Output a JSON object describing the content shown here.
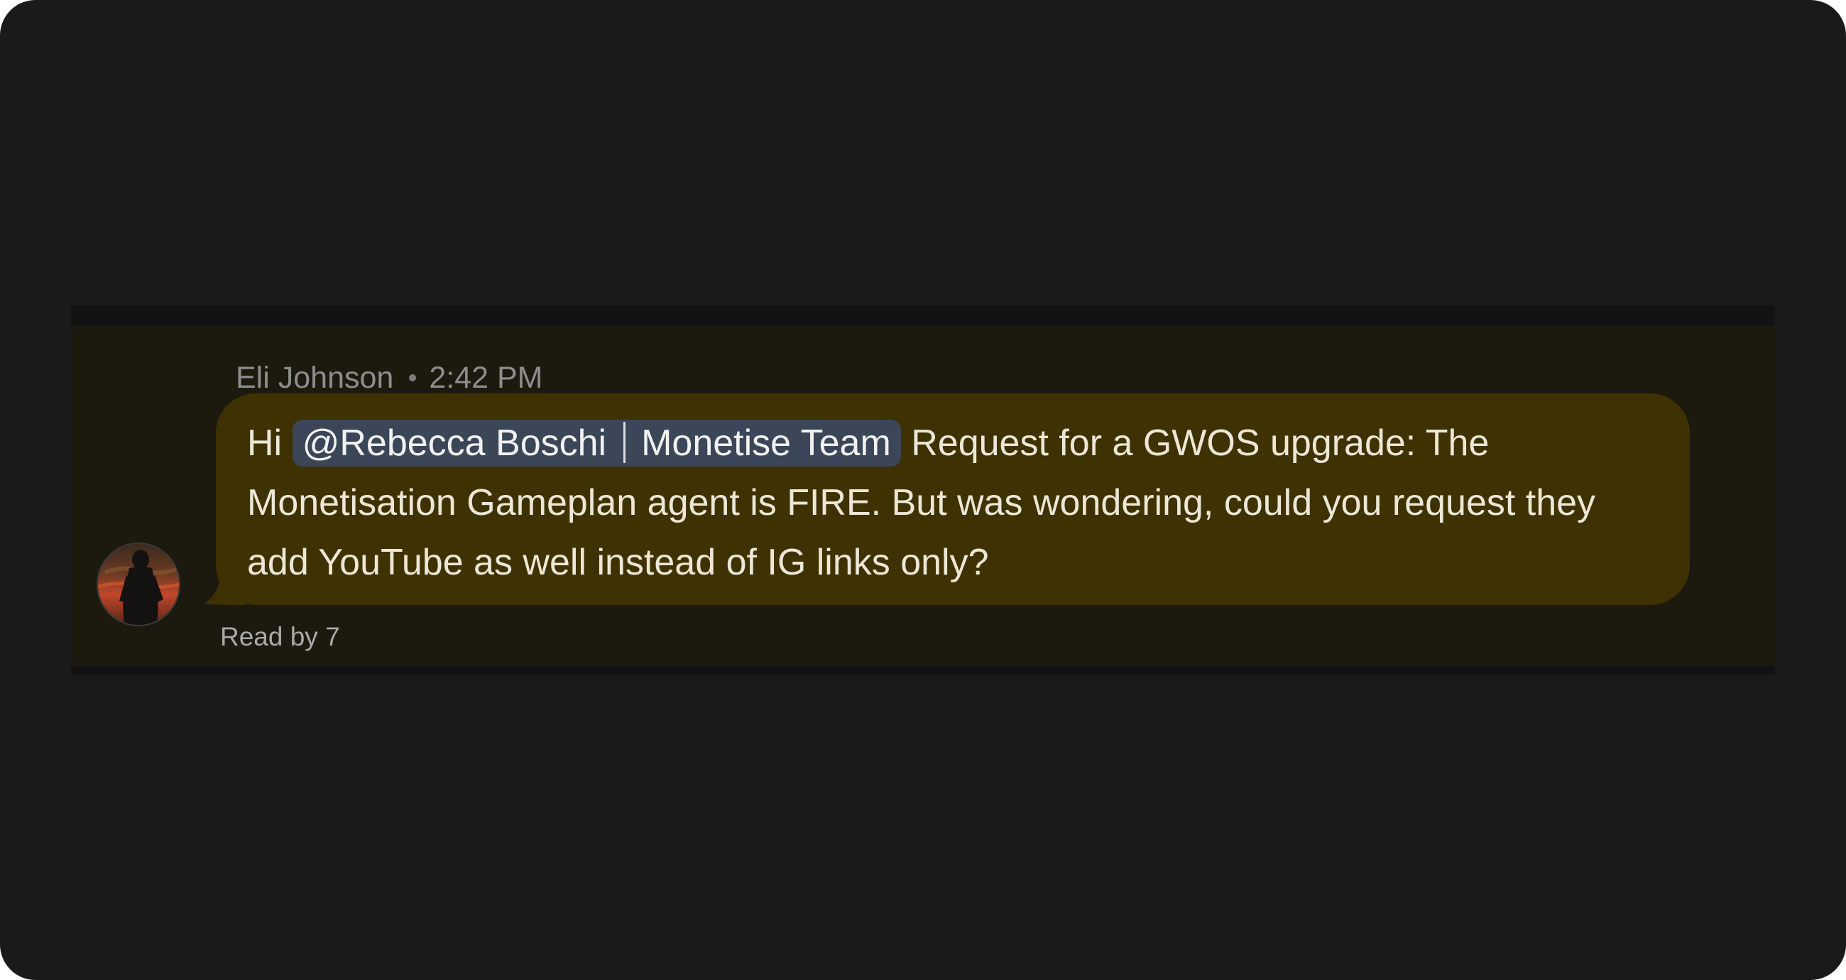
{
  "message": {
    "sender": "Eli Johnson",
    "time": "2:42 PM",
    "greeting": "Hi",
    "mention": {
      "name": "@Rebecca Boschi",
      "team": "Monetise Team"
    },
    "body": "Request for a GWOS upgrade: The Monetisation Gameplan agent is FIRE. But was wondering, could you request they add YouTube as well instead of IG links only?",
    "read_receipt": "Read by 7"
  },
  "colors": {
    "background": "#1a1a1a",
    "row_background": "#1c1a0f",
    "bubble": "#3f3202",
    "mention_chip": "#3b4658",
    "meta_text": "#8d8d8d",
    "bubble_text": "#ece7d6"
  },
  "icons": {
    "avatar": "person-silhouette-sunset-avatar",
    "dot": "bullet-separator-icon"
  }
}
